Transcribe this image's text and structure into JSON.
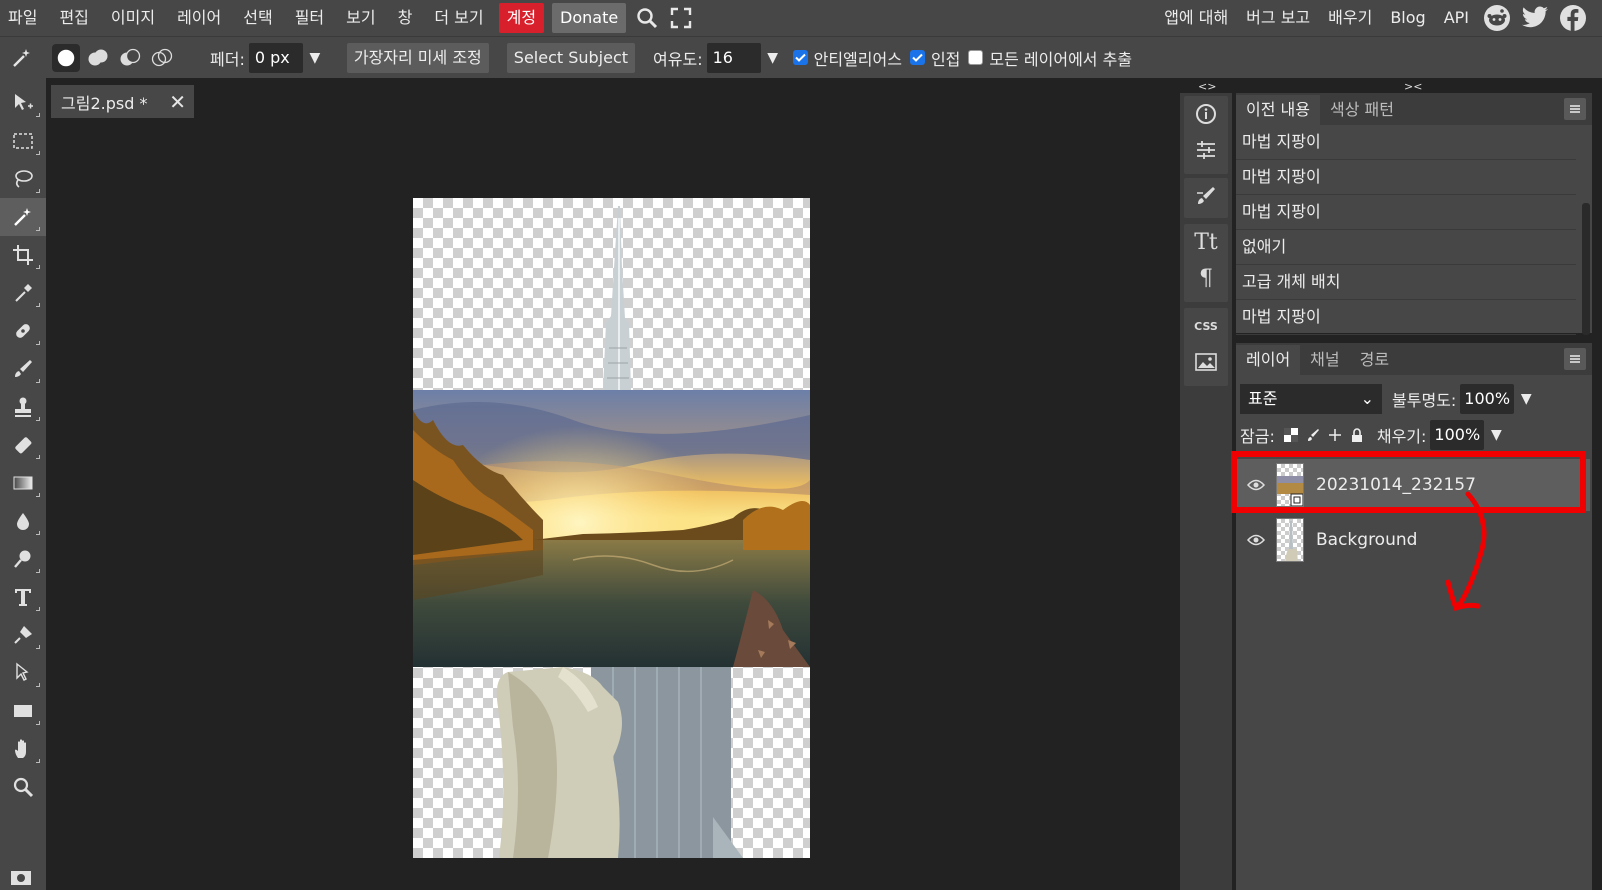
{
  "menubar": {
    "items": [
      "파일",
      "편집",
      "이미지",
      "레이어",
      "선택",
      "필터",
      "보기",
      "창",
      "더 보기"
    ],
    "account": "계정",
    "donate": "Donate",
    "right_links": [
      "앱에 대해",
      "버그 보고",
      "배우기",
      "Blog",
      "API"
    ],
    "social": [
      "reddit-icon",
      "twitter-icon",
      "facebook-icon"
    ]
  },
  "options": {
    "feather_label": "페더:",
    "feather_value": "0 px",
    "refine_edge": "가장자리 미세 조정",
    "select_subject": "Select Subject",
    "tolerance_label": "여유도:",
    "tolerance_value": "16",
    "antialias_label": "안티엘리어스",
    "antialias_checked": true,
    "contiguous_label": "인접",
    "contiguous_checked": true,
    "sample_all_label": "모든 레이어에서 추출",
    "sample_all_checked": false
  },
  "document": {
    "tab_title": "그림2.psd *"
  },
  "history": {
    "tabs": [
      "이전 내용",
      "색상 패턴"
    ],
    "items": [
      "마법 지팡이",
      "마법 지팡이",
      "마법 지팡이",
      "없애기",
      "고급 개체 배치",
      "마법 지팡이"
    ]
  },
  "layers_panel": {
    "tabs": [
      "레이어",
      "채널",
      "경로"
    ],
    "blend_mode": "표준",
    "opacity_label": "불투명도:",
    "opacity_value": "100%",
    "lock_label": "잠금:",
    "fill_label": "채우기:",
    "fill_value": "100%",
    "layers": [
      {
        "name": "20231014_232157",
        "visible": true,
        "selected": true
      },
      {
        "name": "Background",
        "visible": true,
        "selected": false
      }
    ]
  },
  "colors": {
    "account_bg": "#d8202c",
    "highlight": "#f00000",
    "selected_layer_bg": "#5e5e5e"
  }
}
